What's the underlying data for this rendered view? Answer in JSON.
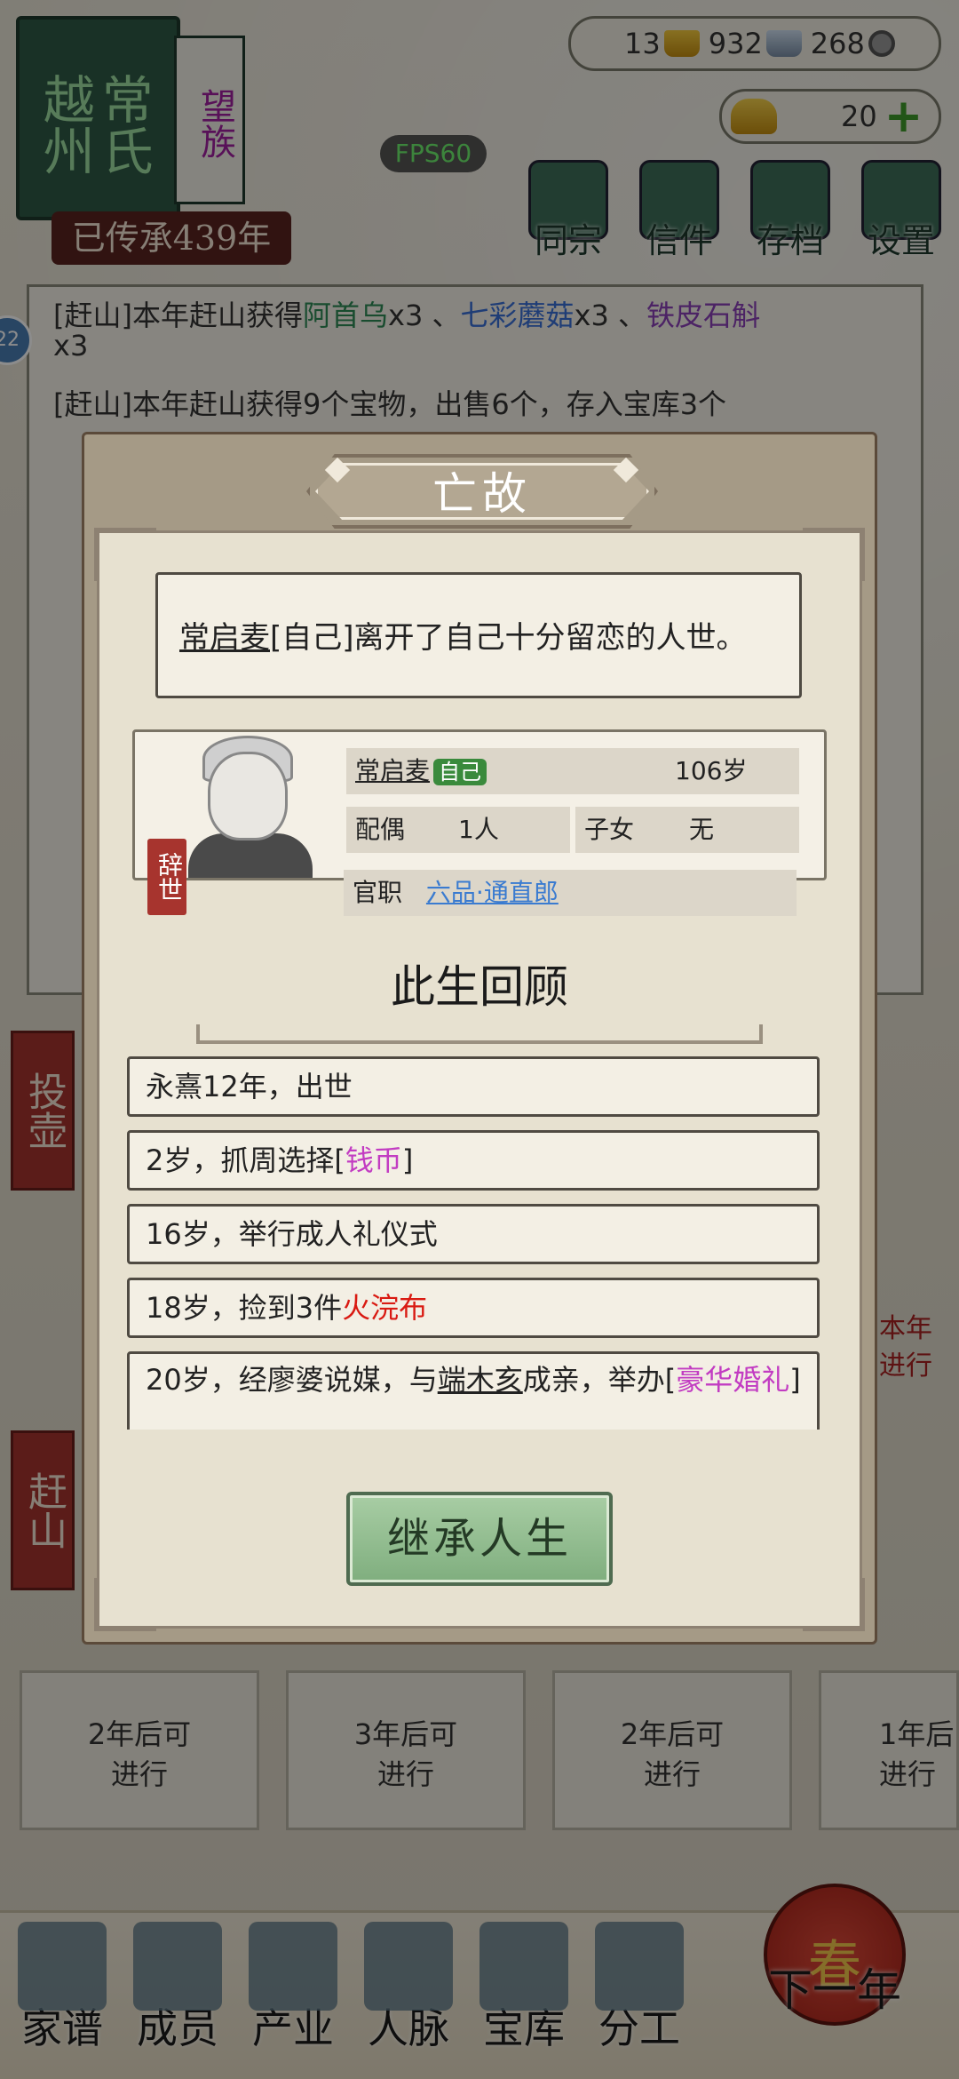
{
  "top": {
    "clan_name": "越州",
    "family_name": "常氏",
    "rank_badge": "望族",
    "inherit_count": "已传承439年",
    "fps": "FPS60",
    "res_copper": "13",
    "res_gold_bars": "932",
    "res_silver_bars": "268",
    "yuanbao": "20",
    "nav": [
      "同宗",
      "信件",
      "存档",
      "设置"
    ]
  },
  "background": {
    "log_line1_prefix": "[赶山]本年赶山获得",
    "log_link1": "阿首乌",
    "log_mid1": "x3 、",
    "log_link2": "七彩蘑菇",
    "log_mid2": "x3 、",
    "log_link3": "铁皮石斛",
    "log_line1_suffix": "x3",
    "log_line2": "[赶山]本年赶山获得9个宝物，出售6个，存入宝库3个",
    "side_buttons": [
      "投壶",
      "赶山"
    ],
    "cards": [
      "2年后可\n进行",
      "3年后可\n进行",
      "2年后可\n进行",
      "1年后\n进行"
    ],
    "right_card": "本年\n进行",
    "side_badge": "22"
  },
  "dialog": {
    "title": "亡故",
    "death_name": "常启麦",
    "death_text": "[自己]离开了自己十分留恋的人世。",
    "seal": "辞世",
    "person": {
      "name": "常启麦",
      "self_tag": "自己",
      "age": "106岁",
      "spouse_label": "配偶",
      "spouse_value": "1人",
      "children_label": "子女",
      "children_value": "无",
      "office_label": "官职",
      "office_value": "六品·通直郎"
    },
    "review_title": "此生回顾",
    "life_events": [
      {
        "text": "永熹12年，出世"
      },
      {
        "pre": "2岁，抓周选择[",
        "hl": "钱币",
        "post": "]"
      },
      {
        "text": "16岁，举行成人礼仪式"
      },
      {
        "pre": "18岁，捡到3件",
        "hl": "火浣布"
      },
      {
        "pre": "20岁，经廖婆说媒，与",
        "name": "端木亥",
        "mid": "成亲，举办[",
        "hl": "豪华婚礼",
        "post": "]"
      }
    ],
    "inherit_button": "继承人生"
  },
  "bottom_nav": [
    "家谱",
    "成员",
    "产业",
    "人脉",
    "宝库",
    "分工",
    "下一年"
  ],
  "lantern": "春"
}
